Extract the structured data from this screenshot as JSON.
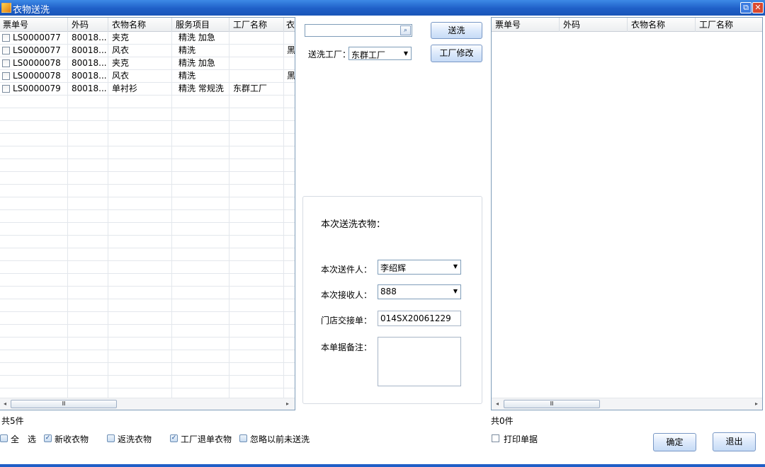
{
  "window": {
    "title": "衣物送洗",
    "restore_glyph": "⧉",
    "close_glyph": "✕"
  },
  "left_grid": {
    "columns": [
      "票单号",
      "外码",
      "衣物名称",
      "服务项目",
      "工厂名称",
      "衣"
    ],
    "rows": [
      {
        "ticket": "LS0000077",
        "code": "80018...",
        "name": "夹克",
        "service": "精洗 加急",
        "factory": "",
        "extra": ""
      },
      {
        "ticket": "LS0000077",
        "code": "80018...",
        "name": "风衣",
        "service": "精洗",
        "factory": "",
        "extra": "黑"
      },
      {
        "ticket": "LS0000078",
        "code": "80018...",
        "name": "夹克",
        "service": "精洗 加急",
        "factory": "",
        "extra": ""
      },
      {
        "ticket": "LS0000078",
        "code": "80018...",
        "name": "风衣",
        "service": "精洗",
        "factory": "",
        "extra": "黑"
      },
      {
        "ticket": "LS0000079",
        "code": "80018...",
        "name": "单衬衫",
        "service": "精洗 常规洗",
        "factory": "东群工厂",
        "extra": ""
      }
    ],
    "count_label": "共5件",
    "scroll_left": "◂",
    "scroll_right": "▸",
    "thumb_grip": "Ⅲ"
  },
  "middle": {
    "search_placeholder": "",
    "search_icon": "⌕",
    "send_button": "送洗",
    "factory_label": "送洗工厂：",
    "factory_value": "东群工厂",
    "factory_edit_button": "工厂修改",
    "dropdown_arrow": "▼",
    "panel_title": "本次送洗衣物：",
    "sender_label": "本次送件人：",
    "sender_value": "李绍辉",
    "receiver_label": "本次接收人：",
    "receiver_value": "888",
    "handover_label": "门店交接单：",
    "handover_value": "014SX20061229",
    "remark_label": "本单据备注：",
    "remark_value": ""
  },
  "right_grid": {
    "columns": [
      "票单号",
      "外码",
      "衣物名称",
      "工厂名称"
    ],
    "count_label": "共0件",
    "scroll_left": "◂",
    "scroll_right": "▸",
    "thumb_grip": "Ⅲ"
  },
  "filters": [
    {
      "label": "全　选",
      "checked": false
    },
    {
      "label": "新收衣物",
      "checked": true
    },
    {
      "label": "返洗衣物",
      "checked": false
    },
    {
      "label": "工厂退单衣物",
      "checked": true
    },
    {
      "label": "忽略以前未送洗",
      "checked": false
    }
  ],
  "check_mark": "✓",
  "print_label": "打印单据",
  "confirm_button": "确定",
  "exit_button": "退出"
}
